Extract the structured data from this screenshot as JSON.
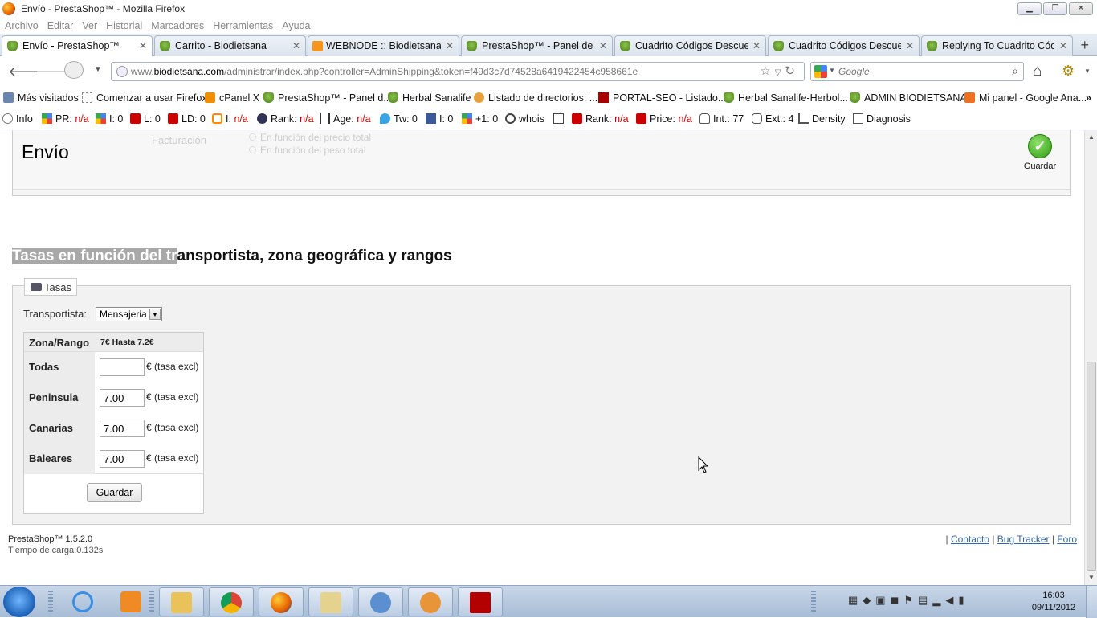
{
  "window": {
    "title": "Envío - PrestaShop™ - Mozilla Firefox"
  },
  "menu": [
    "Archivo",
    "Editar",
    "Ver",
    "Historial",
    "Marcadores",
    "Herramientas",
    "Ayuda"
  ],
  "tabs": [
    {
      "label": "Envío - PrestaShop™"
    },
    {
      "label": "Carrito - Biodietsana"
    },
    {
      "label": "WEBNODE :: Biodietsana"
    },
    {
      "label": "PrestaShop™ - Panel de a..."
    },
    {
      "label": "Cuadrito Códigos Descue..."
    },
    {
      "label": "Cuadrito Códigos Descue..."
    },
    {
      "label": "Replying To Cuadrito Cód..."
    }
  ],
  "nav": {
    "url_pre": "www.",
    "url_domain": "biodietsana.com",
    "url_rest": "/administrar/index.php?controller=AdminShipping&token=f49d3c7d74528a6419422454c958661e",
    "search_placeholder": "Google"
  },
  "bookmarks": [
    {
      "label": "Más visitados"
    },
    {
      "label": "Comenzar a usar Firefox"
    },
    {
      "label": "cPanel X"
    },
    {
      "label": "PrestaShop™ - Panel d..."
    },
    {
      "label": "Herbal Sanalife"
    },
    {
      "label": "Listado de directorios: ..."
    },
    {
      "label": "PORTAL-SEO - Listado..."
    },
    {
      "label": "Herbal Sanalife-Herbol..."
    },
    {
      "label": "ADMIN BIODIETSANA"
    },
    {
      "label": "Mi panel - Google Ana..."
    }
  ],
  "seobar": {
    "info": "Info",
    "pr_label": "PR:",
    "pr_value": "n/a",
    "i1": "I: 0",
    "l": "L: 0",
    "ld": "LD: 0",
    "i2_label": "I:",
    "i2_value": "n/a",
    "rank1_label": "Rank:",
    "rank1_value": "n/a",
    "age_label": "Age:",
    "age_value": "n/a",
    "tw": "Tw: 0",
    "fb": "I: 0",
    "plus": "+1: 0",
    "whois": "whois",
    "rank2_label": "Rank:",
    "rank2_value": "n/a",
    "price_label": "Price:",
    "price_value": "n/a",
    "int": "Int.: 77",
    "ext": "Ext.: 4",
    "density": "Density",
    "diagnosis": "Diagnosis"
  },
  "header": {
    "title": "Envío",
    "ghost_billing": "Facturación",
    "ghost_opt1": "En función del precio total",
    "ghost_opt2": "En función del peso total",
    "save_label": "Guardar"
  },
  "section": {
    "title_highlight": "Tasas en función del tr",
    "title_rest": "ansportista, zona geográfica y rangos"
  },
  "fees": {
    "legend": "Tasas",
    "carrier_label": "Transportista:",
    "carrier_selected": "Mensajeria",
    "col_zone": "Zona/Rango",
    "col_range": "7€ Hasta 7.2€",
    "unit": "€ (tasa excl)",
    "rows": [
      {
        "zone": "Todas",
        "value": ""
      },
      {
        "zone": "Peninsula",
        "value": "7.00"
      },
      {
        "zone": "Canarias",
        "value": "7.00"
      },
      {
        "zone": "Baleares",
        "value": "7.00"
      }
    ],
    "save_label": "Guardar"
  },
  "footer": {
    "version": "PrestaShop™ 1.5.2.0",
    "load_time": "Tiempo de carga:0.132s",
    "sep": "|",
    "links": [
      "Contacto",
      "Bug Tracker",
      "Foro"
    ]
  },
  "taskbar": {
    "time": "16:03",
    "date": "09/11/2012"
  }
}
